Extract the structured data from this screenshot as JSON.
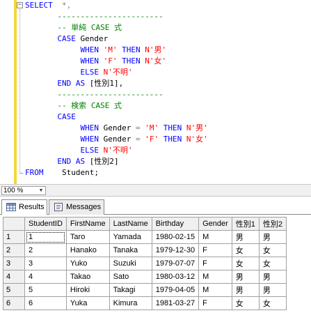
{
  "editor": {
    "lines": [
      [
        {
          "t": "SELECT",
          "c": "kw"
        },
        {
          "t": "  ",
          "c": "tx"
        },
        {
          "t": "*,",
          "c": "gr"
        }
      ],
      [
        {
          "t": "       ",
          "c": "tx"
        },
        {
          "t": "-----------------------",
          "c": "cm"
        }
      ],
      [
        {
          "t": "       ",
          "c": "tx"
        },
        {
          "t": "-- 単純 CASE 式",
          "c": "cm"
        }
      ],
      [
        {
          "t": "       ",
          "c": "tx"
        },
        {
          "t": "CASE",
          "c": "kw"
        },
        {
          "t": " Gender",
          "c": "tx"
        }
      ],
      [
        {
          "t": "            ",
          "c": "tx"
        },
        {
          "t": "WHEN",
          "c": "kw"
        },
        {
          "t": " ",
          "c": "tx"
        },
        {
          "t": "'M'",
          "c": "str"
        },
        {
          "t": " ",
          "c": "tx"
        },
        {
          "t": "THEN",
          "c": "kw"
        },
        {
          "t": " ",
          "c": "tx"
        },
        {
          "t": "N'男'",
          "c": "str"
        }
      ],
      [
        {
          "t": "            ",
          "c": "tx"
        },
        {
          "t": "WHEN",
          "c": "kw"
        },
        {
          "t": " ",
          "c": "tx"
        },
        {
          "t": "'F'",
          "c": "str"
        },
        {
          "t": " ",
          "c": "tx"
        },
        {
          "t": "THEN",
          "c": "kw"
        },
        {
          "t": " ",
          "c": "tx"
        },
        {
          "t": "N'女'",
          "c": "str"
        }
      ],
      [
        {
          "t": "            ",
          "c": "tx"
        },
        {
          "t": "ELSE",
          "c": "kw"
        },
        {
          "t": " ",
          "c": "tx"
        },
        {
          "t": "N'不明'",
          "c": "str"
        }
      ],
      [
        {
          "t": "       ",
          "c": "tx"
        },
        {
          "t": "END",
          "c": "kw"
        },
        {
          "t": " ",
          "c": "tx"
        },
        {
          "t": "AS",
          "c": "kw"
        },
        {
          "t": " [性別1],",
          "c": "tx"
        }
      ],
      [
        {
          "t": "       ",
          "c": "tx"
        },
        {
          "t": "-----------------------",
          "c": "cm"
        }
      ],
      [
        {
          "t": "       ",
          "c": "tx"
        },
        {
          "t": "-- 検索 CASE 式",
          "c": "cm"
        }
      ],
      [
        {
          "t": "       ",
          "c": "tx"
        },
        {
          "t": "CASE",
          "c": "kw"
        }
      ],
      [
        {
          "t": "            ",
          "c": "tx"
        },
        {
          "t": "WHEN",
          "c": "kw"
        },
        {
          "t": " Gender ",
          "c": "tx"
        },
        {
          "t": "=",
          "c": "gr"
        },
        {
          "t": " ",
          "c": "tx"
        },
        {
          "t": "'M'",
          "c": "str"
        },
        {
          "t": " ",
          "c": "tx"
        },
        {
          "t": "THEN",
          "c": "kw"
        },
        {
          "t": " ",
          "c": "tx"
        },
        {
          "t": "N'男'",
          "c": "str"
        }
      ],
      [
        {
          "t": "            ",
          "c": "tx"
        },
        {
          "t": "WHEN",
          "c": "kw"
        },
        {
          "t": " Gender ",
          "c": "tx"
        },
        {
          "t": "=",
          "c": "gr"
        },
        {
          "t": " ",
          "c": "tx"
        },
        {
          "t": "'F'",
          "c": "str"
        },
        {
          "t": " ",
          "c": "tx"
        },
        {
          "t": "THEN",
          "c": "kw"
        },
        {
          "t": " ",
          "c": "tx"
        },
        {
          "t": "N'女'",
          "c": "str"
        }
      ],
      [
        {
          "t": "            ",
          "c": "tx"
        },
        {
          "t": "ELSE",
          "c": "kw"
        },
        {
          "t": " ",
          "c": "tx"
        },
        {
          "t": "N'不明'",
          "c": "str"
        }
      ],
      [
        {
          "t": "       ",
          "c": "tx"
        },
        {
          "t": "END",
          "c": "kw"
        },
        {
          "t": " ",
          "c": "tx"
        },
        {
          "t": "AS",
          "c": "kw"
        },
        {
          "t": " [性別2]",
          "c": "tx"
        }
      ],
      [
        {
          "t": "FROM",
          "c": "kw"
        },
        {
          "t": "    Student;",
          "c": "tx"
        }
      ]
    ],
    "collapse_glyph": "−"
  },
  "zoom": {
    "value": "100 %",
    "arrow": "▼"
  },
  "tabs": [
    {
      "label": "Results",
      "icon": "grid-icon",
      "active": true
    },
    {
      "label": "Messages",
      "icon": "messages-icon",
      "active": false
    }
  ],
  "grid": {
    "columns": [
      "StudentID",
      "FirstName",
      "LastName",
      "Birthday",
      "Gender",
      "性別1",
      "性別2"
    ],
    "rows": [
      {
        "num": "1",
        "cells": [
          "1",
          "Taro",
          "Yamada",
          "1980-02-15",
          "M",
          "男",
          "男"
        ]
      },
      {
        "num": "2",
        "cells": [
          "2",
          "Hanako",
          "Tanaka",
          "1979-12-30",
          "F",
          "女",
          "女"
        ]
      },
      {
        "num": "3",
        "cells": [
          "3",
          "Yuko",
          "Suzuki",
          "1979-07-07",
          "F",
          "女",
          "女"
        ]
      },
      {
        "num": "4",
        "cells": [
          "4",
          "Takao",
          "Sato",
          "1980-03-12",
          "M",
          "男",
          "男"
        ]
      },
      {
        "num": "5",
        "cells": [
          "5",
          "Hiroki",
          "Takagi",
          "1979-04-05",
          "M",
          "男",
          "男"
        ]
      },
      {
        "num": "6",
        "cells": [
          "6",
          "Yuka",
          "Kimura",
          "1981-03-27",
          "F",
          "女",
          "女"
        ]
      }
    ]
  }
}
